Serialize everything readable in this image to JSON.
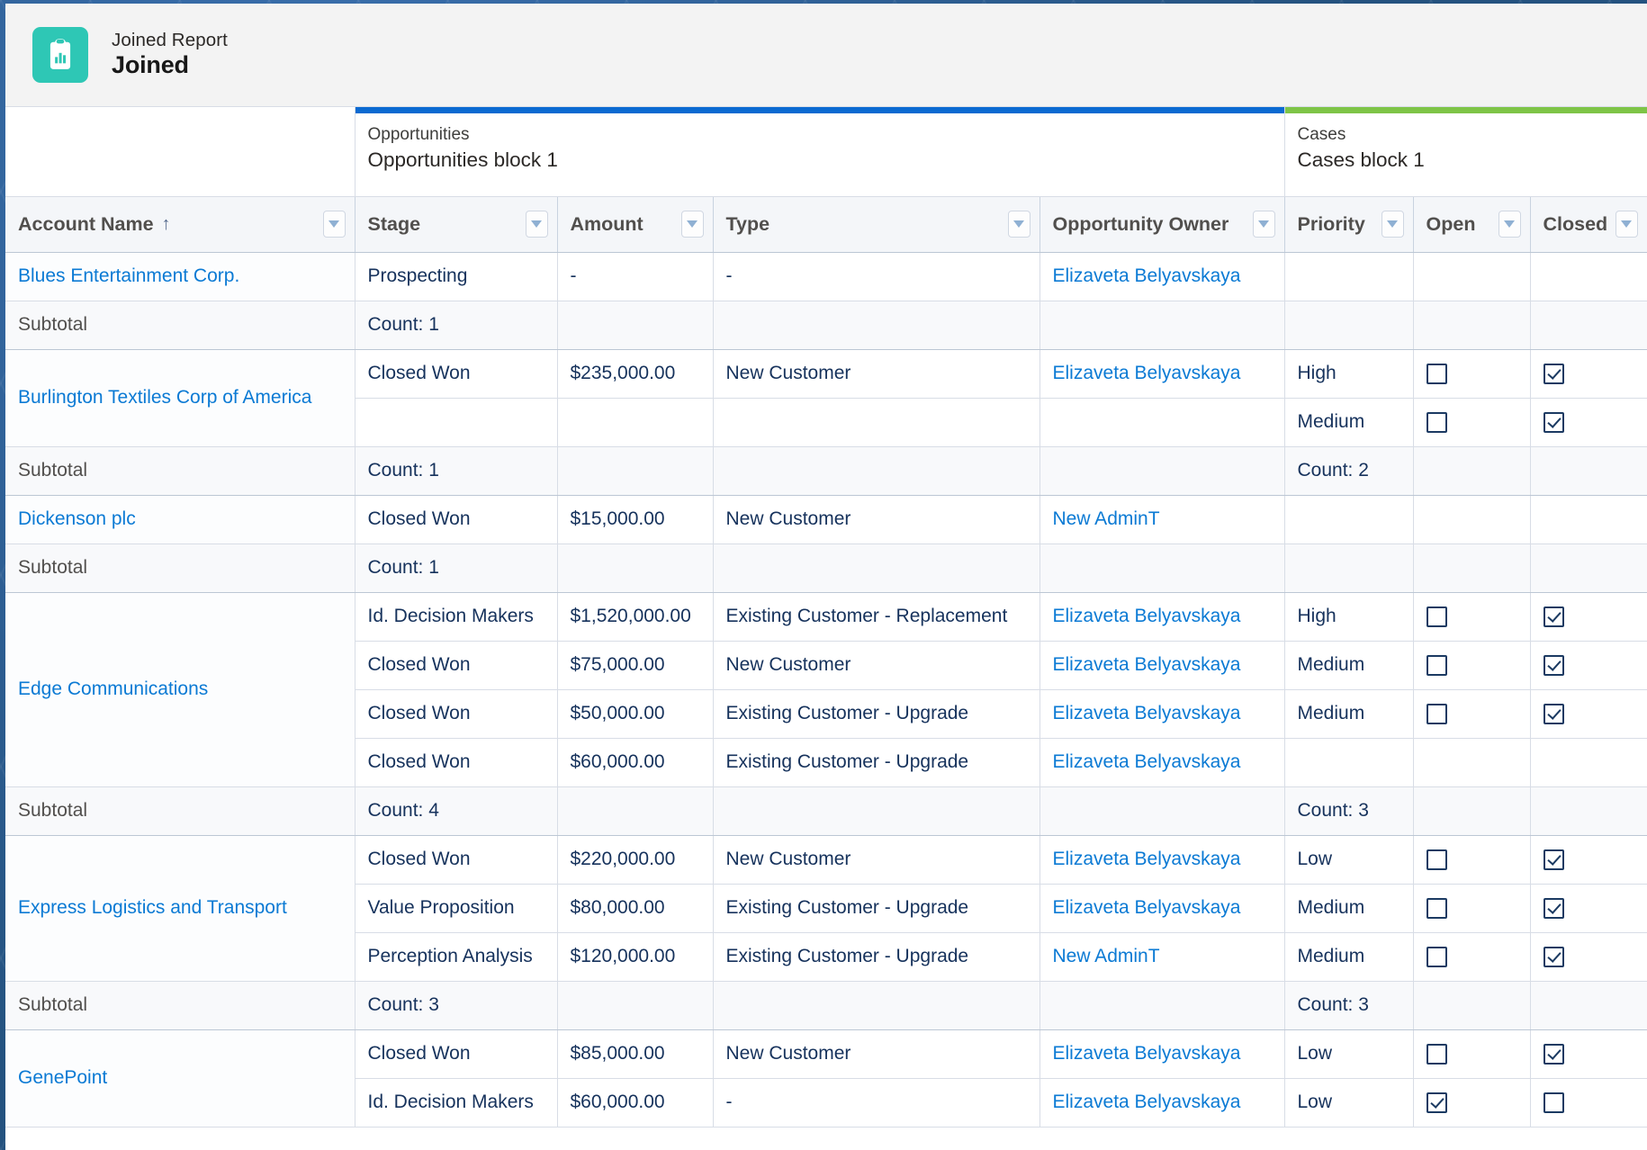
{
  "header": {
    "icon": "report-clipboard-chart-icon",
    "report_type": "Joined Report",
    "report_name": "Joined"
  },
  "blocks": [
    {
      "object": "Opportunities",
      "name": "Opportunities block 1",
      "accent": "#0b6ad1"
    },
    {
      "object": "Cases",
      "name": "Cases block 1",
      "accent": "#7ec447"
    }
  ],
  "columns": {
    "account_name": "Account Name",
    "sort_indicator": "↑",
    "stage": "Stage",
    "amount": "Amount",
    "type": "Type",
    "opportunity_owner": "Opportunity Owner",
    "priority": "Priority",
    "open": "Open",
    "closed": "Closed"
  },
  "labels": {
    "subtotal": "Subtotal",
    "empty_dash": "-"
  },
  "groups": [
    {
      "account": "Blues Entertainment Corp.",
      "rows": [
        {
          "stage": "Prospecting",
          "amount": "-",
          "type": "-",
          "owner": "Elizaveta Belyavskaya",
          "priority": "",
          "open": null,
          "closed": null
        }
      ],
      "subtotal": {
        "stage": "Count: 1",
        "priority": ""
      }
    },
    {
      "account": "Burlington Textiles Corp of America",
      "rows": [
        {
          "stage": "Closed Won",
          "amount": "$235,000.00",
          "type": "New Customer",
          "owner": "Elizaveta Belyavskaya",
          "priority": "High",
          "open": false,
          "closed": true
        },
        {
          "stage": "",
          "amount": "",
          "type": "",
          "owner": "",
          "priority": "Medium",
          "open": false,
          "closed": true
        }
      ],
      "subtotal": {
        "stage": "Count: 1",
        "priority": "Count: 2"
      }
    },
    {
      "account": "Dickenson plc",
      "rows": [
        {
          "stage": "Closed Won",
          "amount": "$15,000.00",
          "type": "New Customer",
          "owner": "New AdminT",
          "priority": "",
          "open": null,
          "closed": null
        }
      ],
      "subtotal": {
        "stage": "Count: 1",
        "priority": ""
      }
    },
    {
      "account": "Edge Communications",
      "rows": [
        {
          "stage": "Id. Decision Makers",
          "amount": "$1,520,000.00",
          "type": "Existing Customer - Replacement",
          "owner": "Elizaveta Belyavskaya",
          "priority": "High",
          "open": false,
          "closed": true
        },
        {
          "stage": "Closed Won",
          "amount": "$75,000.00",
          "type": "New Customer",
          "owner": "Elizaveta Belyavskaya",
          "priority": "Medium",
          "open": false,
          "closed": true
        },
        {
          "stage": "Closed Won",
          "amount": "$50,000.00",
          "type": "Existing Customer - Upgrade",
          "owner": "Elizaveta Belyavskaya",
          "priority": "Medium",
          "open": false,
          "closed": true
        },
        {
          "stage": "Closed Won",
          "amount": "$60,000.00",
          "type": "Existing Customer - Upgrade",
          "owner": "Elizaveta Belyavskaya",
          "priority": "",
          "open": null,
          "closed": null
        }
      ],
      "subtotal": {
        "stage": "Count: 4",
        "priority": "Count: 3"
      }
    },
    {
      "account": "Express Logistics and Transport",
      "rows": [
        {
          "stage": "Closed Won",
          "amount": "$220,000.00",
          "type": "New Customer",
          "owner": "Elizaveta Belyavskaya",
          "priority": "Low",
          "open": false,
          "closed": true
        },
        {
          "stage": "Value Proposition",
          "amount": "$80,000.00",
          "type": "Existing Customer - Upgrade",
          "owner": "Elizaveta Belyavskaya",
          "priority": "Medium",
          "open": false,
          "closed": true
        },
        {
          "stage": "Perception Analysis",
          "amount": "$120,000.00",
          "type": "Existing Customer - Upgrade",
          "owner": "New AdminT",
          "priority": "Medium",
          "open": false,
          "closed": true
        }
      ],
      "subtotal": {
        "stage": "Count: 3",
        "priority": "Count: 3"
      }
    },
    {
      "account": "GenePoint",
      "rows": [
        {
          "stage": "Closed Won",
          "amount": "$85,000.00",
          "type": "New Customer",
          "owner": "Elizaveta Belyavskaya",
          "priority": "Low",
          "open": false,
          "closed": true
        },
        {
          "stage": "Id. Decision Makers",
          "amount": "$60,000.00",
          "type": "-",
          "owner": "Elizaveta Belyavskaya",
          "priority": "Low",
          "open": true,
          "closed": false
        }
      ],
      "subtotal": null
    }
  ]
}
